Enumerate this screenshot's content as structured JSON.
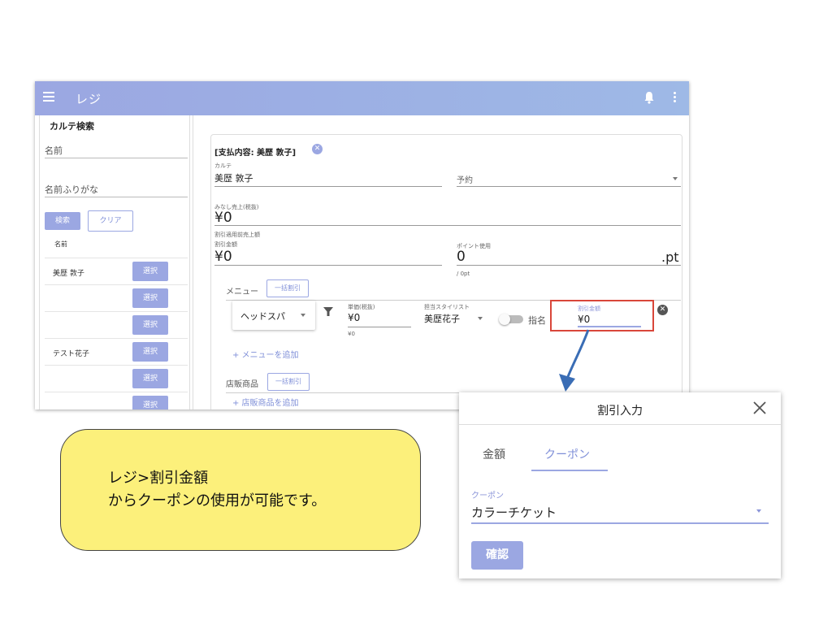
{
  "appbar": {
    "title": "レジ"
  },
  "sidebar": {
    "title": "カルテ検索",
    "name_placeholder": "名前",
    "kana_placeholder": "名前ふりがな",
    "search_label": "検索",
    "clear_label": "クリア",
    "list_header": "名前",
    "rows": [
      {
        "name": "美歴 敦子",
        "select": "選択"
      },
      {
        "name": "",
        "select": "選択"
      },
      {
        "name": "",
        "select": "選択"
      },
      {
        "name": "テスト花子",
        "select": "選択"
      },
      {
        "name": "",
        "select": "選択"
      },
      {
        "name": "",
        "select": "選択"
      }
    ]
  },
  "main": {
    "pay_header": "[支払内容: 美歴 敦子]",
    "karte_label": "カルテ",
    "karte_value": "美歴 敦子",
    "reserve_label": "予約",
    "minashi_label": "みなし売上(税抜)",
    "minashi_value": "¥0",
    "pre_discount_label": "割引適用前売上額",
    "discount_label": "割引金額",
    "discount_value": "¥0",
    "points_label": "ポイント使用",
    "points_value": "0",
    "points_unit": ".pt",
    "points_hint": "/ 0pt",
    "menu_label": "メニュー",
    "bulk_discount_label": "一括割引",
    "menu_select": "ヘッドスパ",
    "unit_price_label": "単価(税抜)",
    "unit_price_value": "¥0",
    "unit_price_hint": "¥0",
    "stylist_label": "担当スタイリスト",
    "stylist_value": "美歴花子",
    "nominate_label": "指名",
    "row_discount_label": "割引金額",
    "row_discount_value": "¥0",
    "add_menu": "+ メニューを追加",
    "products_label": "店販商品",
    "products_bulk_label": "一括割引",
    "add_product": "+ 店販商品を追加"
  },
  "callout": {
    "text": "レジ>割引金額\nからクーポンの使用が可能です。"
  },
  "dialog": {
    "title": "割引入力",
    "tab_amount": "金額",
    "tab_coupon": "クーポン",
    "coupon_label": "クーポン",
    "coupon_value": "カラーチケット",
    "confirm_label": "確認"
  },
  "colors": {
    "accent": "#9ba7e2",
    "highlight_border": "#d9463a",
    "arrow": "#3a6db5",
    "callout": "#fcf07b"
  }
}
